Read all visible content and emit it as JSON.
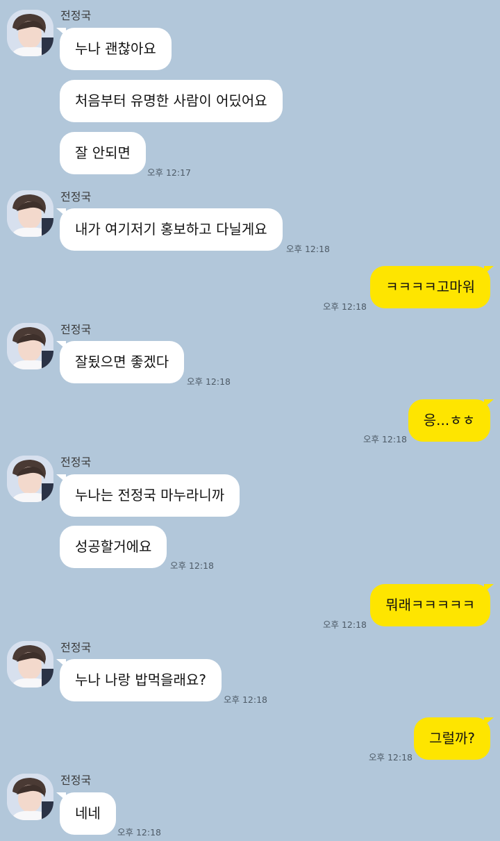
{
  "chat": {
    "contact_name": "전정국",
    "groups": [
      {
        "sender": "전정국",
        "messages": [
          "누나 괜찮아요",
          "처음부터 유명한 사람이 어딨어요",
          "잘 안되면"
        ],
        "time": "오후 12:17"
      },
      {
        "sender": "전정국",
        "messages": [
          "내가 여기저기 홍보하고 다닐게요"
        ],
        "time": "오후 12:18"
      },
      {
        "me": true,
        "messages": [
          "ㅋㅋㅋㅋ고마워"
        ],
        "time": "오후 12:18"
      },
      {
        "sender": "전정국",
        "messages": [
          "잘됬으면 좋겠다"
        ],
        "time": "오후 12:18"
      },
      {
        "me": true,
        "messages": [
          "응...ㅎㅎ"
        ],
        "time": "오후 12:18"
      },
      {
        "sender": "전정국",
        "messages": [
          "누나는 전정국 마누라니까",
          "성공할거에요"
        ],
        "time": "오후 12:18"
      },
      {
        "me": true,
        "messages": [
          "뭐래ㅋㅋㅋㅋㅋ"
        ],
        "time": "오후 12:18"
      },
      {
        "sender": "전정국",
        "messages": [
          "누나 나랑 밥먹을래요?"
        ],
        "time": "오후 12:18"
      },
      {
        "me": true,
        "messages": [
          "그럴까?"
        ],
        "time": "오후 12:18"
      },
      {
        "sender": "전정국",
        "messages": [
          "네네"
        ],
        "time": "오후 12:18"
      }
    ]
  },
  "colors": {
    "background": "#b2c7da",
    "incoming_bubble": "#ffffff",
    "outgoing_bubble": "#fee500"
  },
  "icons": {
    "avatar": "profile-photo"
  }
}
